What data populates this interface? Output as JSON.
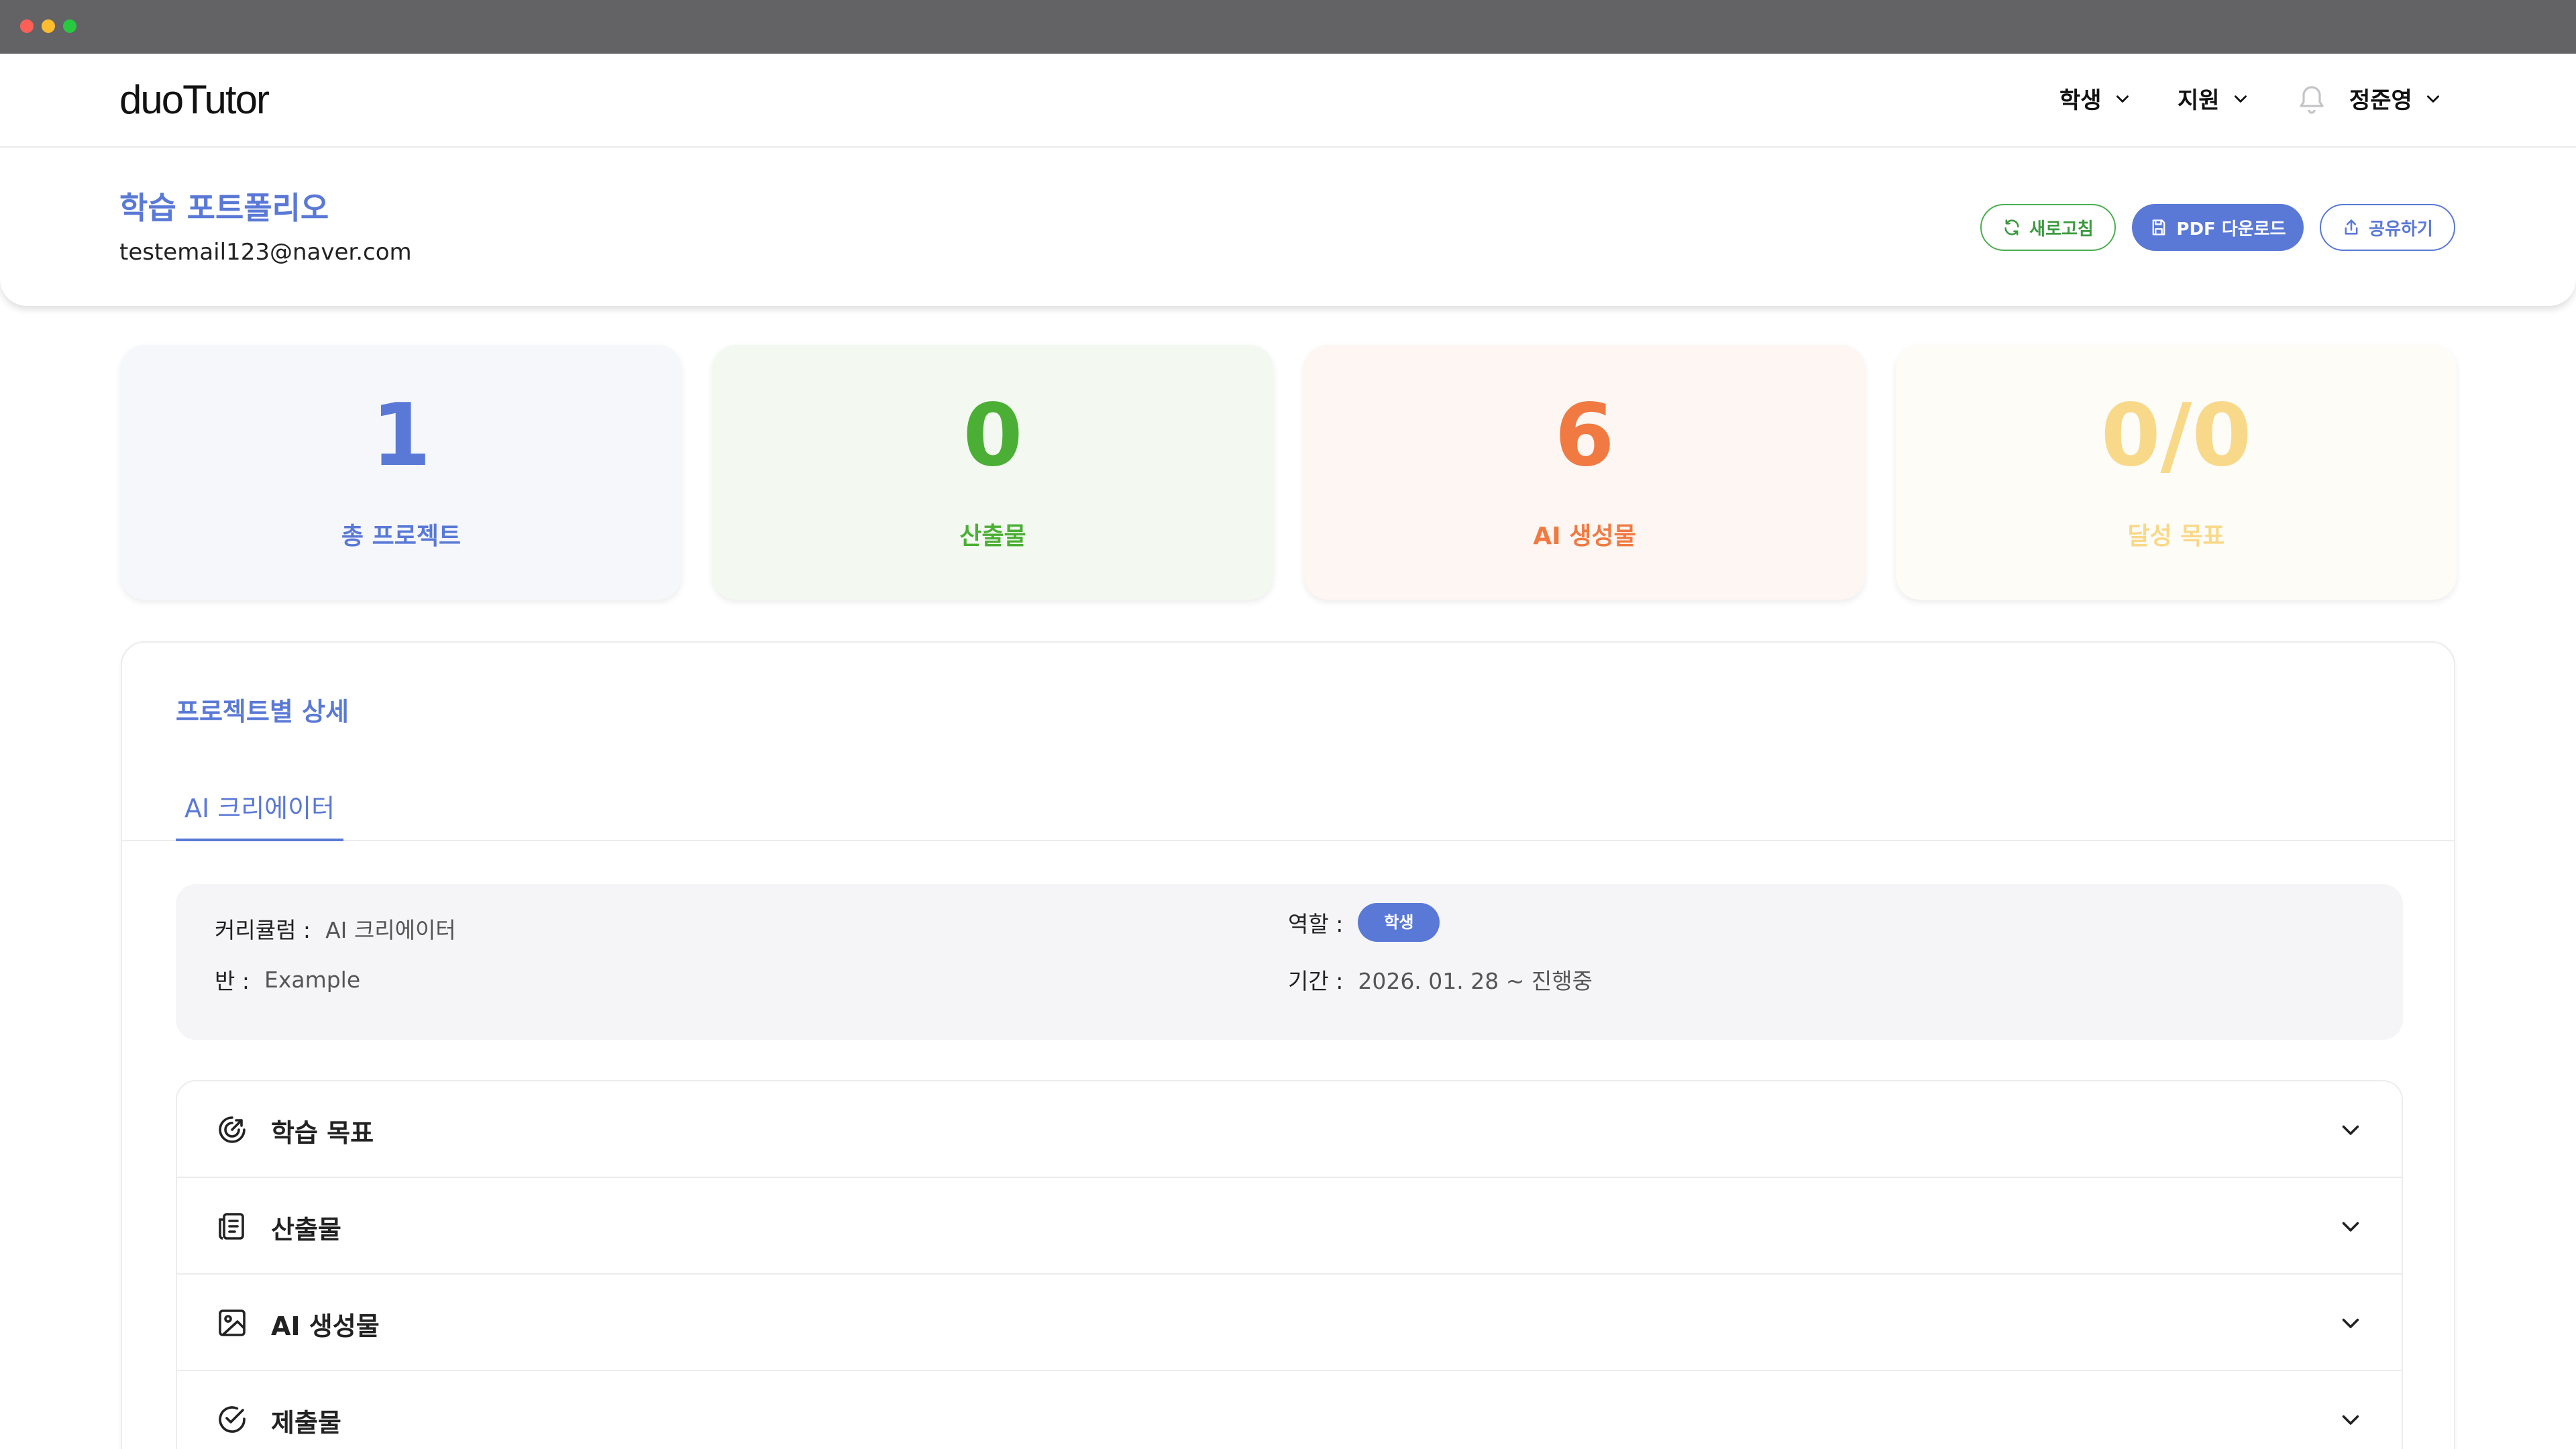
{
  "nav": {
    "logo": "duoTutor",
    "items": [
      {
        "label": "학생"
      },
      {
        "label": "지원"
      }
    ],
    "user": "정준영"
  },
  "header": {
    "title": "학습 포트폴리오",
    "email": "testemail123@naver.com",
    "buttons": {
      "refresh": "새로고침",
      "pdf": "PDF 다운로드",
      "share": "공유하기"
    }
  },
  "stats": [
    {
      "value": "1",
      "label": "총 프로젝트",
      "color": "#5a79d6"
    },
    {
      "value": "0",
      "label": "산출물",
      "color": "#4caf35"
    },
    {
      "value": "6",
      "label": "AI 생성물",
      "color": "#f07a42"
    },
    {
      "value": "0/0",
      "label": "달성 목표",
      "color": "#f8d98a"
    }
  ],
  "detail": {
    "title": "프로젝트별 상세",
    "tabs": [
      {
        "label": "AI 크리에이터",
        "active": true
      }
    ],
    "info": {
      "curriculum_key": "커리큘럼 :",
      "curriculum_val": "AI 크리에이터",
      "class_key": "반 :",
      "class_val": "Example",
      "role_key": "역할 :",
      "role_val": "학생",
      "period_key": "기간 :",
      "period_val": "2026. 01. 28 ~ 진행중"
    },
    "sections": [
      {
        "label": "학습 목표",
        "icon": "target-icon"
      },
      {
        "label": "산출물",
        "icon": "document-icon"
      },
      {
        "label": "AI 생성물",
        "icon": "image-icon"
      },
      {
        "label": "제출물",
        "icon": "check-circle-icon"
      }
    ]
  }
}
